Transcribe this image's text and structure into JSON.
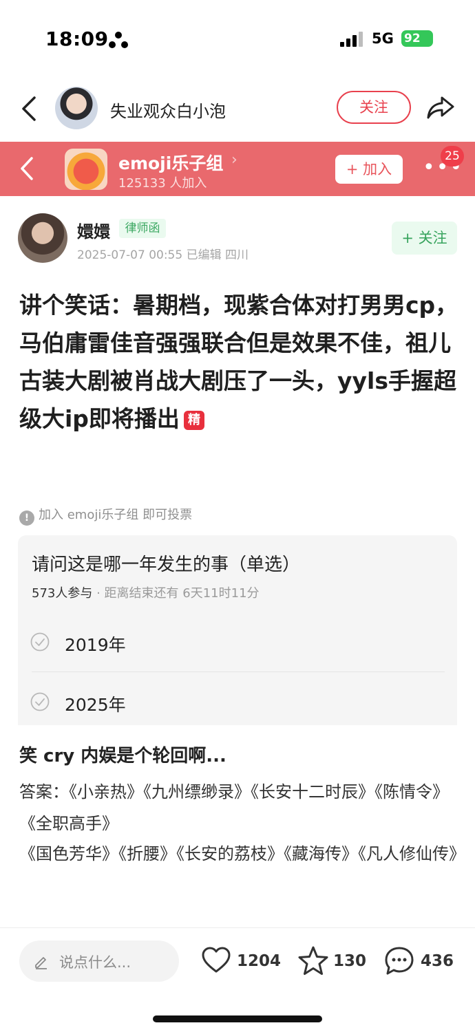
{
  "status_bar": {
    "time": "18:09",
    "network": "5G",
    "battery": "92"
  },
  "top_nav": {
    "author": "失业观众白小泡",
    "follow_label": "关注"
  },
  "group": {
    "name": "emoji乐子组",
    "chevron": "›",
    "members": "125133 人加入",
    "join_label": "+ 加入",
    "badge": "25"
  },
  "post": {
    "poster": "嬛嬛",
    "tag": "律师函",
    "meta": "2025-07-07 00:55  已编辑  四川",
    "follow_label": "+ 关注",
    "title": "讲个笑话：暑期档，现紫合体对打男男cp，马伯庸雷佳音强强联合但是效果不佳，祖儿古装大剧被肖战大剧压了一头，yyls手握超级大ip即将播出",
    "jing": "精"
  },
  "vote": {
    "note": "加入 emoji乐子组 即可投票",
    "question": "请问这是哪一年发生的事（单选）",
    "participants": "573人参与",
    "deadline": "· 距离结束还有 6天11时11分",
    "options": [
      "2019年",
      "2025年"
    ]
  },
  "body": {
    "heading": "笑 cry 内娱是个轮回啊...",
    "line1": "答案：《小亲热》《九州缥缈录》《长安十二时辰》《陈情令》《全职高手》",
    "line2": "《国色芳华》《折腰》《长安的荔枝》《藏海传》《凡人修仙传》"
  },
  "bottom": {
    "placeholder": "说点什么...",
    "likes": "1204",
    "stars": "130",
    "comments": "436"
  },
  "colors": {
    "accent_red": "#e8404d",
    "banner": "#e9696d",
    "green": "#36a35c"
  }
}
